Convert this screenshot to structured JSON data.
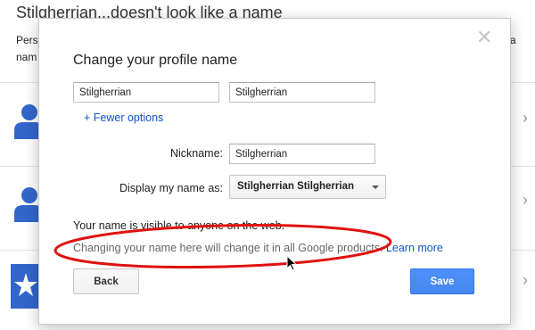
{
  "background": {
    "title": "Stilgherrian...doesn't look like a name",
    "line1_left": "Pers",
    "line1_right": "a",
    "line2_left": "nam"
  },
  "dialog": {
    "title": "Change your profile name",
    "first_name": "Stilgherrian",
    "last_name": "Stilgherrian",
    "fewer_options": "+ Fewer options",
    "nickname_label": "Nickname:",
    "nickname_value": "Stilgherrian",
    "display_label": "Display my name as:",
    "display_value": "Stilgherrian Stilgherrian",
    "visible_note": "Your name is visible to anyone on the web.",
    "change_note": "Changing your name here will change it in all Google products.",
    "learn_more": "Learn more",
    "back_label": "Back",
    "save_label": "Save",
    "close_symbol": "✕"
  },
  "icons": {
    "close": "close-icon",
    "caret": "chevron-down-icon",
    "person": "person-icon",
    "chevron": "chevron-right-icon",
    "cursor": "mouse-pointer-icon"
  },
  "colors": {
    "link": "#1155cc",
    "save_button": "#4d90fe",
    "annotation_ellipse": "#e01010",
    "person_icon": "#3366cc"
  }
}
